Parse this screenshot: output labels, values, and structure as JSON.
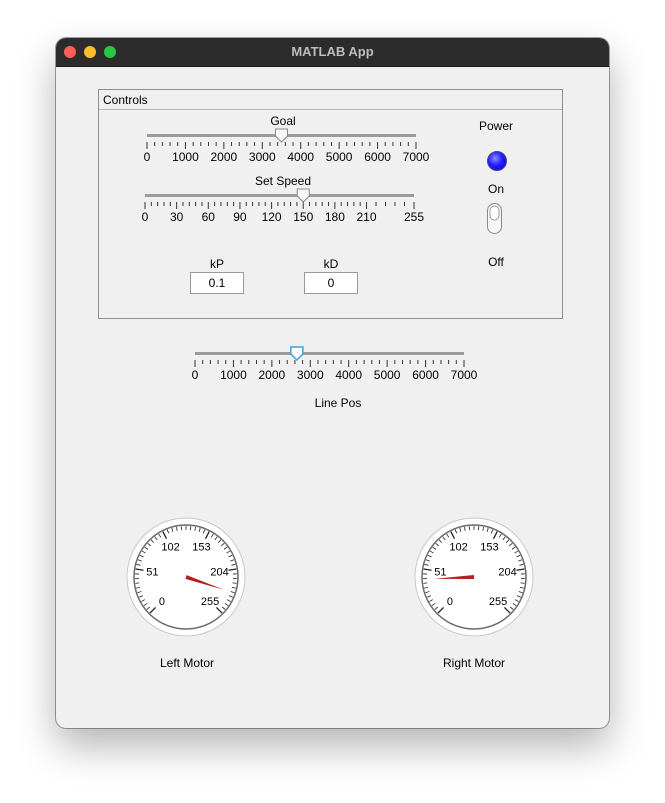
{
  "window": {
    "title": "MATLAB App"
  },
  "controls_panel": {
    "title": "Controls",
    "goal_slider": {
      "label": "Goal",
      "min": 0,
      "max": 7000,
      "value": 3500,
      "ticks": [
        "0",
        "1000",
        "2000",
        "3000",
        "4000",
        "5000",
        "6000",
        "7000"
      ]
    },
    "speed_slider": {
      "label": "Set Speed",
      "min": 0,
      "max": 255,
      "value": 150,
      "ticks": [
        "0",
        "30",
        "60",
        "90",
        "120",
        "150",
        "180",
        "210",
        "255"
      ],
      "tick_values": [
        0,
        30,
        60,
        90,
        120,
        150,
        180,
        210,
        255
      ]
    },
    "kp": {
      "label": "kP",
      "value": "0.1"
    },
    "kd": {
      "label": "kD",
      "value": "0"
    },
    "power": {
      "label": "Power",
      "lamp_color": "#1a1aff"
    },
    "switch": {
      "on_label": "On",
      "off_label": "Off",
      "state": "off"
    }
  },
  "line_pos_slider": {
    "label": "Line Pos",
    "min": 0,
    "max": 7000,
    "value": 2650,
    "ticks": [
      "0",
      "1000",
      "2000",
      "3000",
      "4000",
      "5000",
      "6000",
      "7000"
    ],
    "accent": "#3da0e0"
  },
  "left_motor": {
    "label": "Left Motor",
    "value": 230,
    "ticks": [
      "0",
      "51",
      "102",
      "153",
      "204",
      "255"
    ]
  },
  "right_motor": {
    "label": "Right Motor",
    "value": 40,
    "ticks": [
      "0",
      "51",
      "102",
      "153",
      "204",
      "255"
    ]
  }
}
